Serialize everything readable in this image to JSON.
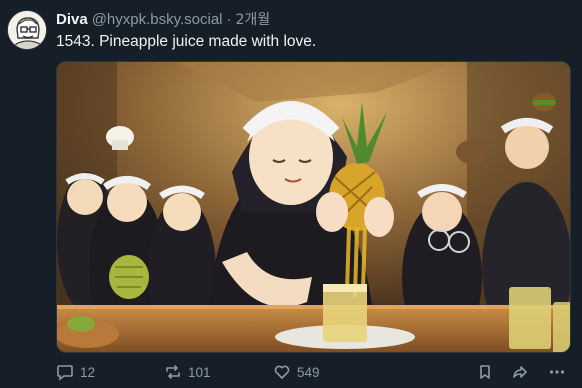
{
  "author": {
    "display_name": "Diva",
    "handle": "@hyxpk.bsky.social",
    "separator": "·",
    "timestamp": "2개월"
  },
  "post": {
    "text": "1543. Pineapple juice made with love.",
    "media_icon": "illustration-image"
  },
  "actions": {
    "reply_count": "12",
    "repost_count": "101",
    "like_count": "549"
  },
  "icons": {
    "reply": "comment-bubble-icon",
    "repost": "repost-arrows-icon",
    "like": "heart-icon",
    "bookmark": "bookmark-icon",
    "share": "share-arrow-icon",
    "more": "more-dots-icon"
  },
  "colors": {
    "background": "#161e27",
    "text_primary": "#f1f3f5",
    "text_secondary": "#8d9aa7"
  }
}
